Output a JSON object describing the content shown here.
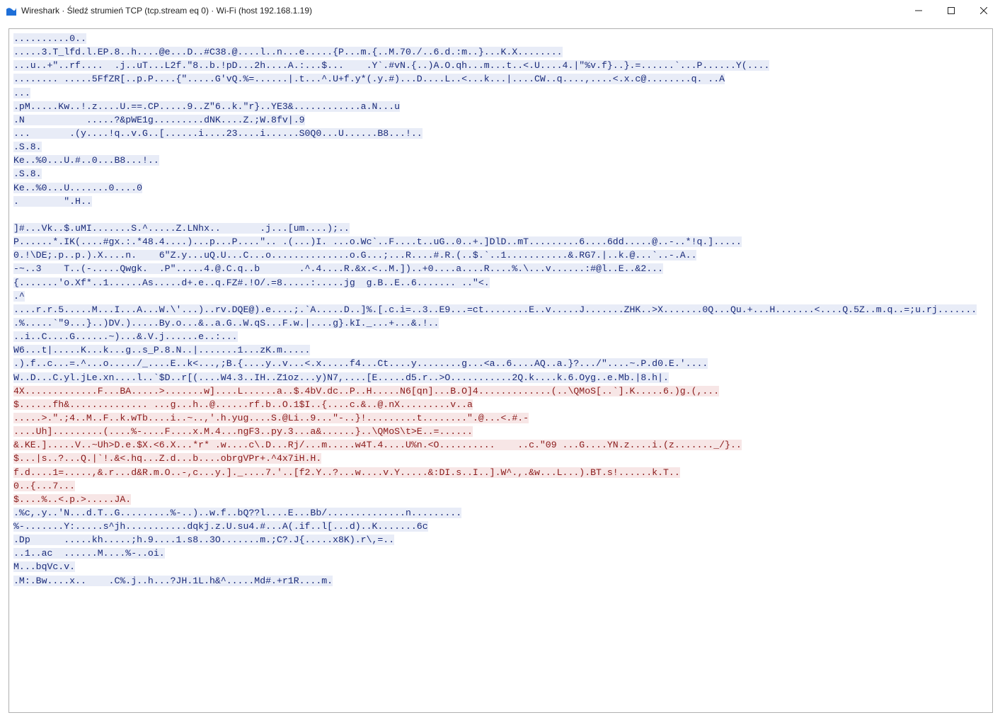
{
  "window": {
    "title": "Wireshark · Śledź strumień TCP (tcp.stream eq 0) · Wi-Fi (host 192.168.1.19)",
    "icon_name": "wireshark-fin-icon",
    "icon_color": "#1e6fd8"
  },
  "colors": {
    "client_fg": "#8a1a1a",
    "client_bg": "#f7e6e6",
    "server_fg": "#1a2b7a",
    "server_bg": "#e8ecf7"
  },
  "stream": {
    "segments": [
      {
        "dir": "server",
        "text": "..........0..\n.....3.T_lfd.l.EP.8..h....@e...D..#C38.@....l..n...e.....{P...m.{..M.70./..6.d.:m..}...K.X........\n...u..+\"..rf....  .j..uT...L2f.\"8..b.!pD...2h....A.:...$...    .Y`.#vN.{..)A.O.qh...m...t..<.U....4.|\"%v.f}..}.=......`...P......Y(....\n........ .....5FfZR[..p.P....{\".....G'vQ.%=......|.t...^.U+f.y*(.y.#)...D....L..<...k...|....CW..q....,....<.x.c@........q. ..A\n...\n.pM.....Kw..!.z....U.==.CP.....9..Z\"6..k.\"r}..YE3&............a.N...u\n.N           .....?&pWE1g.........dNK....Z.;W.8fv|.9\n...       .(y....!q..v.G..[......i....23....i......S0Q0...U......B8...!..\n.S.8.\nKe..%0...U.#..0...B8...!..\n.S.8.\nKe..%0...U.......0....0\n.        \".H..\n\n]#...Vk..$.uMI.......S.^.....Z.LNhx..       .j...[um....);..\nP......*.IK(....#gx.:.*48.4....)...p...P....\".. .(...)I. ...o.Wc`..F....t..uG..0..+.]DlD..mT.........6....6dd.....@..-..*!q.].....\n0.!\\DE;.p..p.).X....n.    6\"Z.y...uQ.U...C...o..............o.G...;...R....#.R.(..$.`..1...........&.RG7.|..k.@...`..-.A..\n-~..3    T..(-.....Qwgk.  .P\".....4.@.C.q..b       .^.4....R.&x.<..M.])..+0....a....R....%.\\...v......:#@l..E..&2...\n{.......'o.Xf*..1......As.....d+.e..q.FZ#.!O/.=8.....:.....jg  g.B..E..6....... ..\"<.\n.^\n....r.r.5.....M...I...A...W.\\'...)..rv.DQE@).e....;.`A.....D..]%.[.c.i=..3..E9...=ct........E..v.....J.......ZHK..>X.......0Q...Qu.+...H.......<....Q.5Z..m.q..=;u.rj.......\n.%.....`\"9...}..)DV.).....By.o...&..a.G..W.qS...F.w.|....g}.kI._...+...&.!..\n..i..C....G......~)...&.V.j......e..:...\nW6...t|.....K...k...g..s_P.8.N..|.......1...zK.m.....\n.).f..c...=.^...o...../_....E..k<...,;B.{....y..v...<.x.....f4...Ct....y........g...<a..6....AQ..a.}?.../\"....~.P.d0.E.'....\nW..D...C.yl.jLe.xn....l..`$D..r[(....W4.3..IH..Z1oz...y)N7,....[E.....d5.r..>O...........2Q.k....k.6.Oyg..e.Mb.|8.h|."
      },
      {
        "dir": "client",
        "text": "4X.............F...BA.....>.......w]....L......a..$.4bV.dc..P..H.....N6[qn]...B.O]4.............(..\\QMoS[..`].K.....6.)g.(,...\n$......fh&.............. ...g...h..@......rf.b..O.1$I..{....c.&..@.nX.........v..a\n.....>.\".;4..M..F..k.wTb....i..~..,'.h.yug....S.@Li..9...\"-..}!.........t........\".@...<.#.-\n....Uh].........(....%-....F....x.M.4...ngF3..py.3...a&......}..\\QMoS\\t>E..=......\n&.KE.].....V..~Uh>D.e.$X.<6.X...*r* .w....c\\.D...Rj/...m.....w4T.4....U%n.<O..........    ..c.\"09 ...G....YN.z....i.(z......._/}..\n$...|s..?...Q.|`!.&<.hq...Z.d...b....obrgVPr+.^4x7iH.H.\nf.d....1=.....,&.r...d&R.m.O..-,c...y.]._....7.'..[f2.Y..?...w....v.Y.....&:DI.s..I..].W^.,.&w...L...).BT.s!......k.T..\n0..{...7...\n$....%..<.p.>.....JA."
      },
      {
        "dir": "server",
        "text": ".%c,.y..'N...d.T..G.........%-..)..w.f..bQ??l....E...Bb/..............n.........\n%-.......Y:.....s^jh...........dqkj.z.U.su4.#...A(.if..l[...d)..K.......6c\n.Dp      .....kh.....;h.9....1.s8..3O.......m.;C?.J{.....x8K).r\\,=..\n..1..ac  ......M....%-..oi.\nM...bqVc.v.\n.M:.Bw....x..    .C%.j..h...?JH.1L.h&^.....Md#.+r1R....m."
      }
    ]
  }
}
